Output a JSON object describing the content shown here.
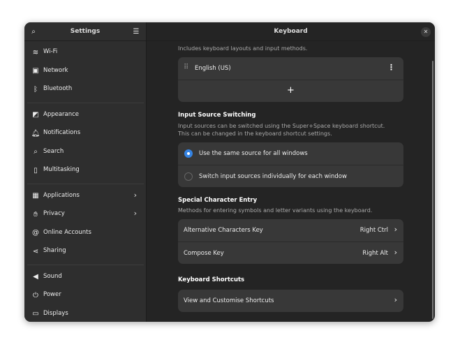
{
  "sidebar": {
    "title": "Settings",
    "groups": [
      [
        {
          "label": "Wi-Fi",
          "icon": "wifi-icon",
          "glyph": "≋"
        },
        {
          "label": "Network",
          "icon": "network-icon",
          "glyph": "▣"
        },
        {
          "label": "Bluetooth",
          "icon": "bluetooth-icon",
          "glyph": "ᛒ"
        }
      ],
      [
        {
          "label": "Appearance",
          "icon": "appearance-icon",
          "glyph": "◩"
        },
        {
          "label": "Notifications",
          "icon": "bell-icon",
          "glyph": "🔔︎"
        },
        {
          "label": "Search",
          "icon": "search-icon",
          "glyph": "⌕"
        },
        {
          "label": "Multitasking",
          "icon": "multitasking-icon",
          "glyph": "▯"
        }
      ],
      [
        {
          "label": "Applications",
          "icon": "applications-icon",
          "glyph": "▦",
          "chevron": true
        },
        {
          "label": "Privacy",
          "icon": "hand-icon",
          "glyph": "✋︎",
          "chevron": true
        },
        {
          "label": "Online Accounts",
          "icon": "at-icon",
          "glyph": "@"
        },
        {
          "label": "Sharing",
          "icon": "share-icon",
          "glyph": "⋖"
        }
      ],
      [
        {
          "label": "Sound",
          "icon": "speaker-icon",
          "glyph": "◀"
        },
        {
          "label": "Power",
          "icon": "power-icon",
          "glyph": "⏻"
        },
        {
          "label": "Displays",
          "icon": "display-icon",
          "glyph": "▭"
        }
      ]
    ]
  },
  "main": {
    "title": "Keyboard",
    "input_sources": {
      "description": "Includes keyboard layouts and input methods.",
      "items": [
        "English (US)"
      ],
      "add_label": "+"
    },
    "switching": {
      "heading": "Input Source Switching",
      "description1": "Input sources can be switched using the Super+Space keyboard shortcut.",
      "description2": "This can be changed in the keyboard shortcut settings.",
      "options": [
        {
          "label": "Use the same source for all windows",
          "selected": true
        },
        {
          "label": "Switch input sources individually for each window",
          "selected": false
        }
      ]
    },
    "special": {
      "heading": "Special Character Entry",
      "description": "Methods for entering symbols and letter variants using the keyboard.",
      "rows": [
        {
          "label": "Alternative Characters Key",
          "value": "Right Ctrl"
        },
        {
          "label": "Compose Key",
          "value": "Right Alt"
        }
      ]
    },
    "shortcuts": {
      "heading": "Keyboard Shortcuts",
      "row_label": "View and Customise Shortcuts"
    }
  },
  "colors": {
    "accent": "#3584e4"
  }
}
